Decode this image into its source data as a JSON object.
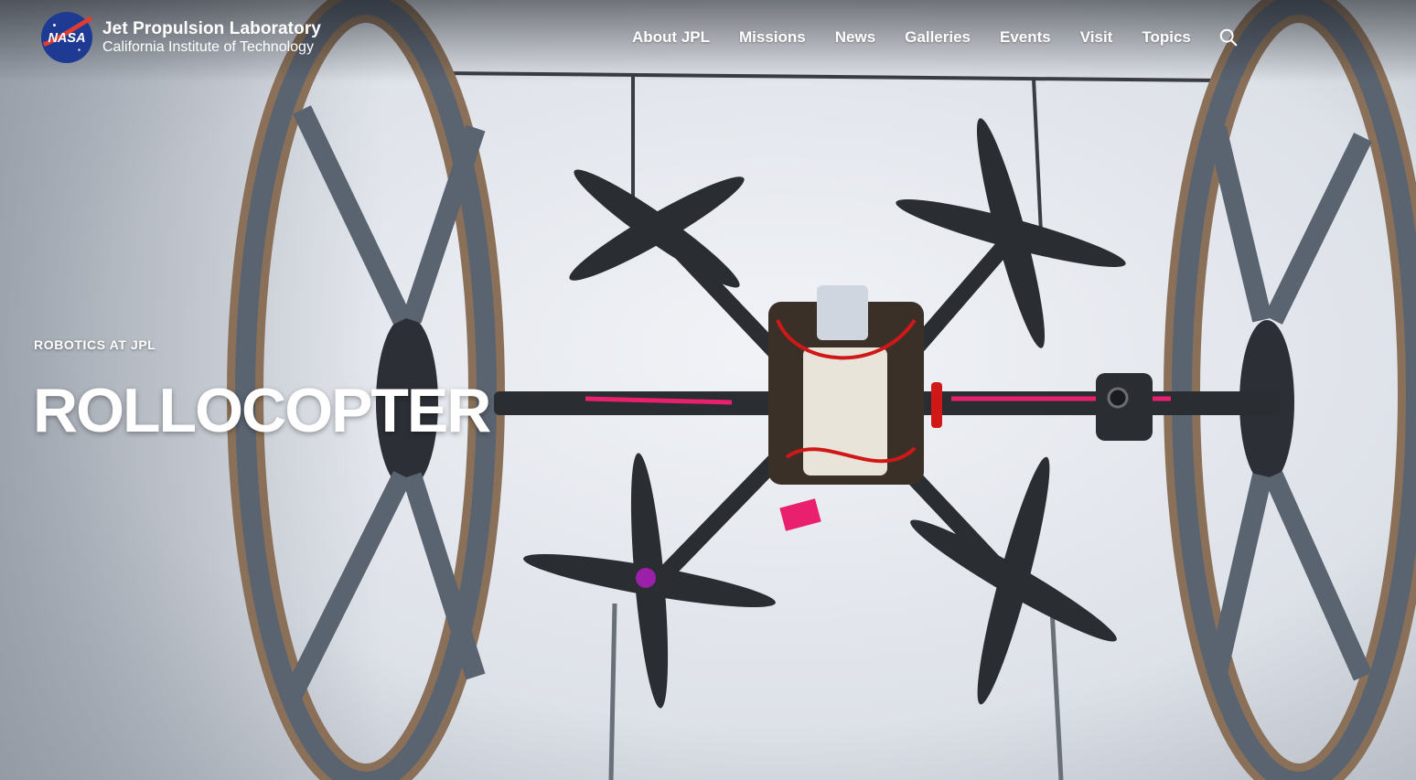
{
  "header": {
    "logo_alt": "NASA",
    "org_title": "Jet Propulsion Laboratory",
    "org_subtitle": "California Institute of Technology"
  },
  "nav": {
    "items": [
      {
        "label": "About JPL"
      },
      {
        "label": "Missions"
      },
      {
        "label": "News"
      },
      {
        "label": "Galleries"
      },
      {
        "label": "Events"
      },
      {
        "label": "Visit"
      },
      {
        "label": "Topics"
      }
    ],
    "search_icon": "search-icon"
  },
  "hero": {
    "eyebrow": "ROBOTICS AT JPL",
    "title": "ROLLOCOPTER",
    "image_subject": "rollocopter-drone-photo"
  },
  "colors": {
    "nasa_blue": "#1f3a93",
    "nasa_red": "#e03c31",
    "text": "#ffffff",
    "wheel": "#5a6370",
    "prop": "#2a2d32",
    "accent_pink": "#e8206e"
  }
}
